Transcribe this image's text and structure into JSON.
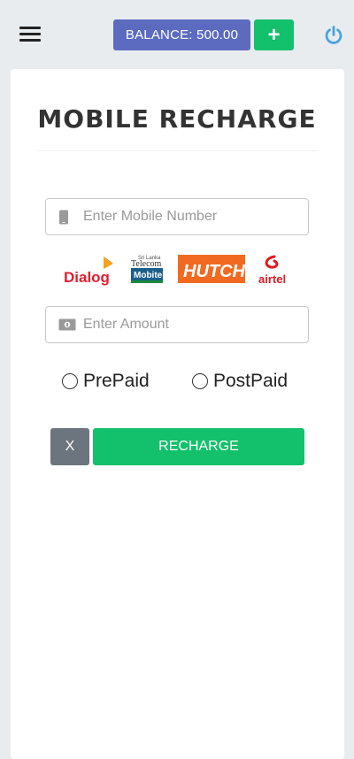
{
  "header": {
    "balance_label": "BALANCE: 500.00",
    "add_label": "+",
    "menu_icon": "hamburger-menu-icon",
    "power_icon": "power-icon"
  },
  "form": {
    "title": "MOBILE RECHARGE",
    "mobile_placeholder": "Enter Mobile Number",
    "amount_placeholder": "Enter Amount",
    "operators": [
      {
        "name": "Dialog",
        "color": "#e0202f"
      },
      {
        "name": "Sri Lanka Telecom Mobitel",
        "color": "#1b8a3c"
      },
      {
        "name": "HUTCH",
        "color": "#f26a21"
      },
      {
        "name": "airtel",
        "color": "#e21b22"
      }
    ],
    "plan_options": [
      "PrePaid",
      "PostPaid"
    ],
    "clear_label": "X",
    "recharge_label": "RECHARGE"
  },
  "colors": {
    "balance_bg": "#5c6bc0",
    "primary_green": "#13c06b",
    "secondary_gray": "#6c757d",
    "power_blue": "#4aa3e0"
  }
}
